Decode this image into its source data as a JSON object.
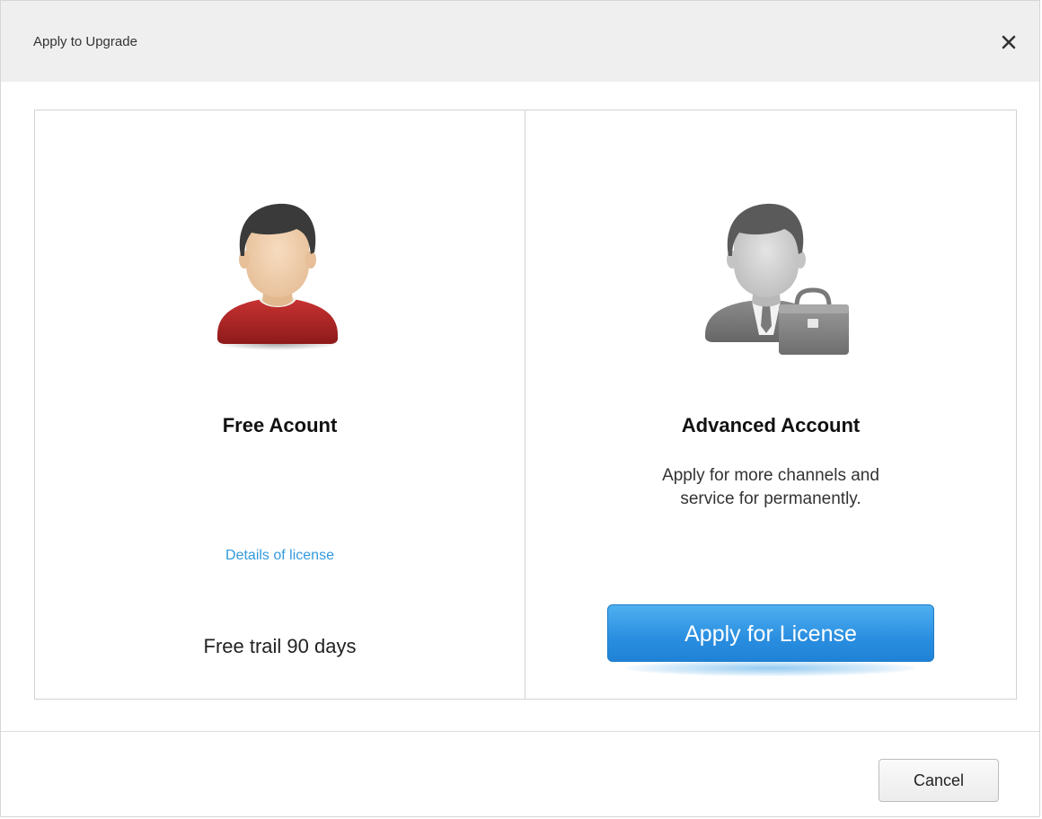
{
  "dialog": {
    "title": "Apply to Upgrade",
    "close_icon": "close-icon"
  },
  "free_account": {
    "avatar_icon": "user-avatar-icon",
    "heading": "Free Acount",
    "details_link": "Details of license",
    "trial_text": "Free trail 90 days"
  },
  "advanced_account": {
    "avatar_icon": "business-user-briefcase-icon",
    "heading": "Advanced Account",
    "description_line1": "Apply for more channels and",
    "description_line2": "service for permanently.",
    "apply_button": "Apply for License"
  },
  "footer": {
    "cancel_button": "Cancel"
  },
  "colors": {
    "titlebar_bg": "#efefef",
    "link": "#3399dd",
    "primary_button": "#2a8ee0",
    "avatar_shirt": "#c02a2a"
  }
}
